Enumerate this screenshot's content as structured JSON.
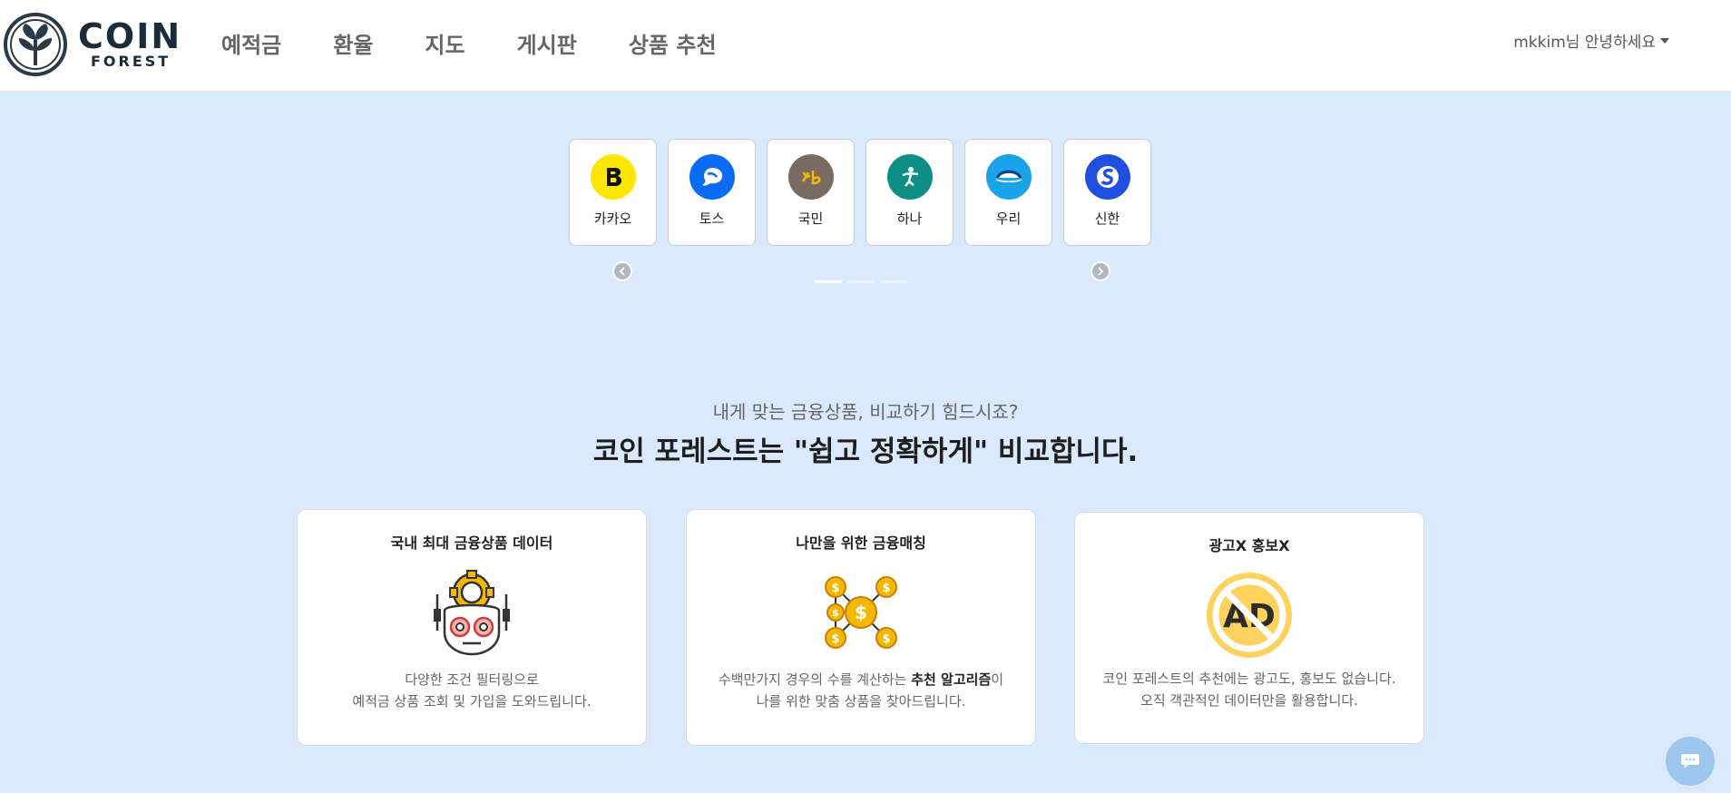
{
  "brand": {
    "coin": "COIN",
    "forest": "FOREST"
  },
  "nav": {
    "items": [
      "예적금",
      "환율",
      "지도",
      "게시판",
      "상품 추천"
    ],
    "user_greeting": "mkkim님 안녕하세요"
  },
  "banks": [
    {
      "name": "카카오",
      "color": "#ffe600",
      "icon": "kakao-icon"
    },
    {
      "name": "토스",
      "color": "#0a6cf5",
      "icon": "toss-icon"
    },
    {
      "name": "국민",
      "color": "#786c62",
      "icon": "kb-icon"
    },
    {
      "name": "하나",
      "color": "#0e8f85",
      "icon": "hana-icon"
    },
    {
      "name": "우리",
      "color": "#1aa3e8",
      "icon": "woori-icon"
    },
    {
      "name": "신한",
      "color": "#1f4fe0",
      "icon": "shinhan-icon"
    }
  ],
  "carousel": {
    "pages": 3,
    "active": 0
  },
  "hero": {
    "subtitle": "내게 맞는 금융상품, 비교하기 힘드시죠?",
    "headline": "코인 포레스트는 \"쉽고 정확하게\" 비교합니다."
  },
  "features": [
    {
      "title": "국내 최대 금융상품 데이터",
      "line1": "다양한 조건 필터링으로",
      "line2": "예적금 상품 조회 및 가입을 도와드립니다.",
      "icon": "robot-gear-icon"
    },
    {
      "title": "나만을 위한 금융매칭",
      "line1_pre": "수백만가지 경우의 수를 계산하는 ",
      "line1_bold": "추천 알고리즘",
      "line1_post": "이",
      "line2": "나를 위한 맞춤 상품을 찾아드립니다.",
      "icon": "coin-network-icon"
    },
    {
      "title": "광고X 홍보X",
      "line1": "코인 포레스트의 추천에는 광고도, 홍보도 없습니다.",
      "line2": "오직 객관적인 데이터만을 활용합니다.",
      "icon": "no-ad-icon",
      "badge": "AD"
    }
  ],
  "colors": {
    "page_bg": "#dbe9fd",
    "coin_gold": "#f5b800",
    "ad_yellow": "#ffd25e"
  }
}
